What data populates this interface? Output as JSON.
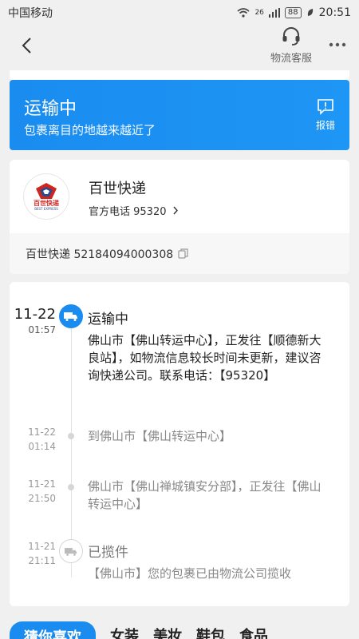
{
  "status_bar": {
    "carrier": "中国移动",
    "network": "26",
    "battery": "88",
    "time": "20:51"
  },
  "header": {
    "service_label": "物流客服"
  },
  "banner": {
    "title": "运输中",
    "subtitle": "包裹离目的地越来越近了",
    "report_label": "报错",
    "color": "#1a8cf0"
  },
  "company": {
    "logo_cn": "百世快递",
    "logo_en": "BEST EXPRESS",
    "name": "百世快递",
    "phone_label": "官方电话 95320",
    "tracking": "百世快递 52184094000308"
  },
  "timeline": [
    {
      "date": "11-22",
      "time": "01:57",
      "status": "运输中",
      "text": "佛山市【佛山转运中心】，正发往【顺德新大良站】，如物流信息较长时间未更新，建议咨询快递公司。联系电话：【95320】"
    },
    {
      "date": "11-22",
      "time": "01:14",
      "text": "到佛山市【佛山转运中心】"
    },
    {
      "date": "11-21",
      "time": "21:50",
      "text": "佛山市【佛山禅城镇安分部】，正发往【佛山转运中心】"
    },
    {
      "date": "11-21",
      "time": "21:11",
      "status": "已揽件",
      "text": "【佛山市】您的包裹已由物流公司揽收"
    }
  ],
  "tabs": [
    "猜你喜欢",
    "女装",
    "美妆",
    "鞋包",
    "食品"
  ]
}
